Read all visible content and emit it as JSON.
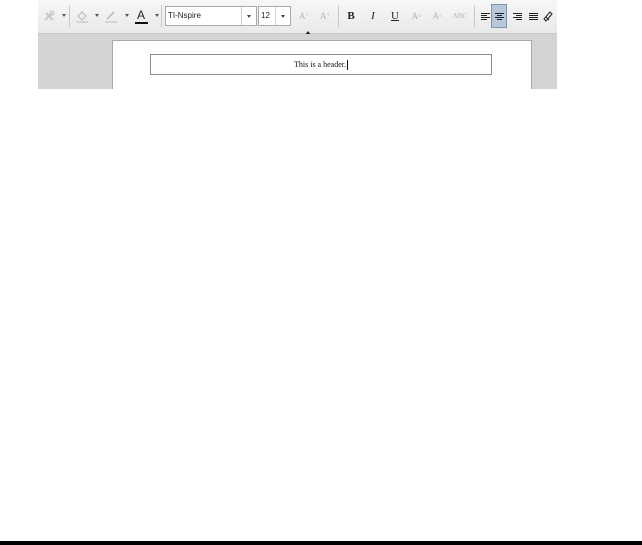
{
  "toolbar": {
    "font_name": "TI-Nspire",
    "font_size": "12",
    "bold_label": "B",
    "italic_label": "I",
    "underline_label": "U",
    "grow_font_label": "A",
    "shrink_font_label": "A",
    "superscript_label": "A",
    "subscript_label": "A",
    "strikethrough_label": "ABC",
    "text_color_label": "A",
    "alignment_selected": "center",
    "icons": [
      "tools-icon",
      "fill-color-icon",
      "line-color-icon",
      "text-color-icon",
      "align-left-icon",
      "align-center-icon",
      "align-right-icon",
      "align-justify-icon",
      "eraser-icon"
    ]
  },
  "document": {
    "header_text": "This is a header."
  },
  "colors": {
    "toolbar_bg": "#efefef",
    "workspace_bg": "#d4d4d4",
    "active_button": "#b9c8d8",
    "text_color_underline": "#111111"
  }
}
